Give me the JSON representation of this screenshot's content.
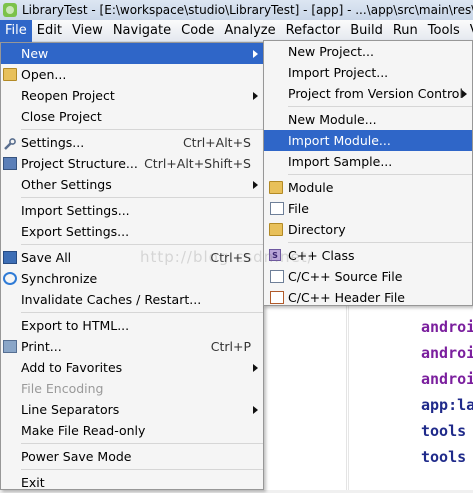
{
  "window": {
    "title": "LibraryTest - [E:\\workspace\\studio\\LibraryTest] - [app] - ...\\app\\src\\main\\res\\lay"
  },
  "menubar": [
    {
      "label": "File"
    },
    {
      "label": "Edit"
    },
    {
      "label": "View"
    },
    {
      "label": "Navigate"
    },
    {
      "label": "Code"
    },
    {
      "label": "Analyze"
    },
    {
      "label": "Refactor"
    },
    {
      "label": "Build"
    },
    {
      "label": "Run"
    },
    {
      "label": "Tools"
    },
    {
      "label": "VCS"
    }
  ],
  "file_menu": {
    "new": "New",
    "open": "Open...",
    "reopen_project": "Reopen Project",
    "close_project": "Close Project",
    "settings": "Settings...",
    "settings_shortcut": "Ctrl+Alt+S",
    "project_structure": "Project Structure...",
    "project_structure_shortcut": "Ctrl+Alt+Shift+S",
    "other_settings": "Other Settings",
    "import_settings": "Import Settings...",
    "export_settings": "Export Settings...",
    "save_all": "Save All",
    "save_all_shortcut": "Ctrl+S",
    "synchronize": "Synchronize",
    "invalidate_caches": "Invalidate Caches / Restart...",
    "export_html": "Export to HTML...",
    "print": "Print...",
    "print_shortcut": "Ctrl+P",
    "add_to_favorites": "Add to Favorites",
    "file_encoding": "File Encoding",
    "line_separators": "Line Separators",
    "make_read_only": "Make File Read-only",
    "power_save": "Power Save Mode",
    "exit": "Exit"
  },
  "new_menu": {
    "new_project": "New Project...",
    "import_project": "Import Project...",
    "project_from_vcs": "Project from Version Control",
    "new_module": "New Module...",
    "import_module": "Import Module...",
    "import_sample": "Import Sample...",
    "module": "Module",
    "file": "File",
    "directory": "Directory",
    "cpp_class": "C++ Class",
    "cpp_source": "C/C++ Source File",
    "cpp_header": "C/C++ Header File"
  },
  "editor": {
    "lines": [
      {
        "text": "androi",
        "color": "#7b1f9e"
      },
      {
        "text": "androi",
        "color": "#7b1f9e"
      },
      {
        "text": "androi",
        "color": "#7b1f9e"
      },
      {
        "text": "app:la",
        "color": "#1f2a8a"
      },
      {
        "text": "tools",
        "color": "#1f2a8a"
      },
      {
        "text": "tools",
        "color": "#1f2a8a"
      }
    ]
  },
  "watermark": "http://blog.csdn.net/",
  "colors": {
    "selection": "#2f66c8",
    "menu_bg": "#f5f5f5"
  }
}
